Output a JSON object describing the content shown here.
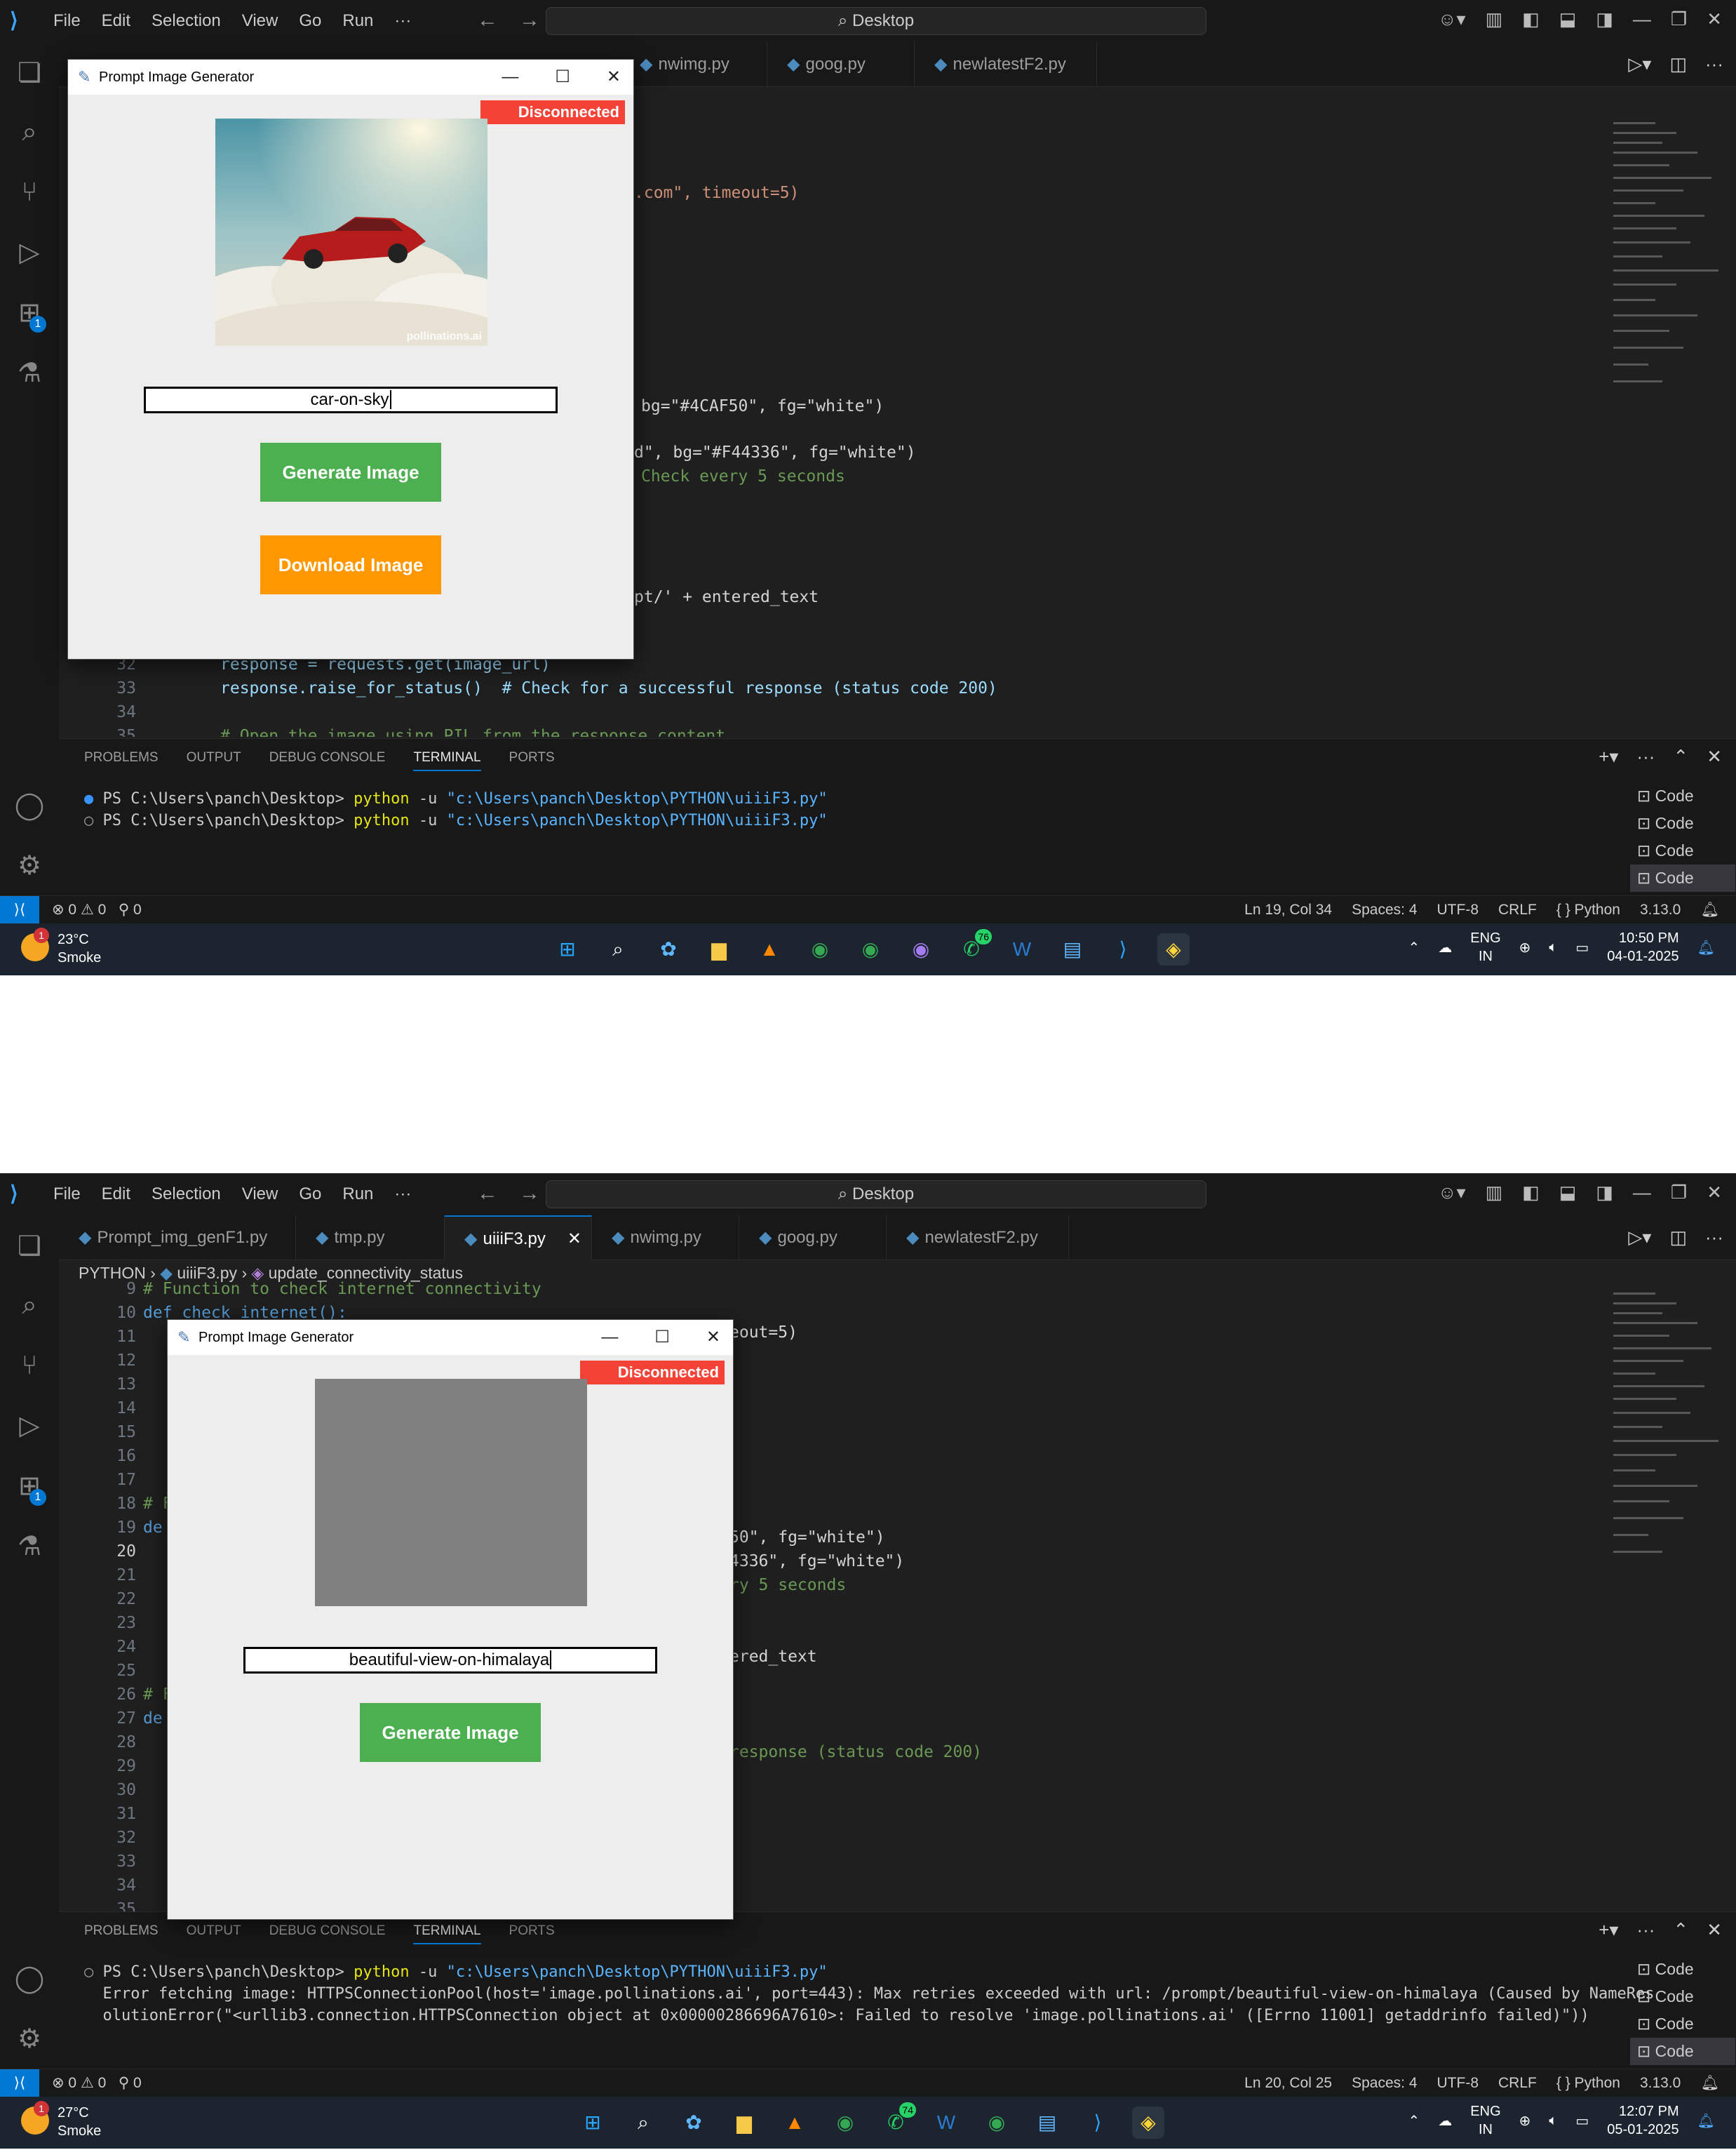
{
  "menu": [
    "File",
    "Edit",
    "Selection",
    "View",
    "Go",
    "Run",
    "···"
  ],
  "search": {
    "label": "Desktop"
  },
  "tabs": {
    "s1": [
      "nwimg.py",
      "goog.py",
      "newlatestF2.py"
    ],
    "s2": [
      "Prompt_img_genF1.py",
      "tmp.py",
      "uiiiF3.py",
      "nwimg.py",
      "goog.py",
      "newlatestF2.py"
    ]
  },
  "breadcrumb": {
    "folder": "PYTHON",
    "file": "uiiiF3.py",
    "symbol": "update_connectivity_status"
  },
  "editor1": {
    "lines": [
      {
        "n": "32",
        "text": "response = requests.get(image_url)"
      },
      {
        "n": "33",
        "text": "response.raise_for_status()  # Check for a successful response (status code 200)"
      },
      {
        "n": "34",
        "text": ""
      },
      {
        "n": "35",
        "text": "# Open the image using PIL from the response content"
      }
    ],
    "frag": [
      ".com\", timeout=5)",
      "bg=\"#4CAF50\", fg=\"white\")",
      "d\", bg=\"#F44336\", fg=\"white\")",
      "Check every 5 seconds",
      "pt/' + entered_text"
    ]
  },
  "editor2": {
    "lines": [
      {
        "n": "9",
        "text": "# Function to check internet connectivity"
      },
      {
        "n": "10",
        "text": "def check_internet():"
      },
      {
        "n": "11",
        "text": ""
      },
      {
        "n": "12",
        "text": ""
      },
      {
        "n": "13",
        "text": ""
      },
      {
        "n": "14",
        "text": ""
      },
      {
        "n": "15",
        "text": ""
      },
      {
        "n": "16",
        "text": ""
      },
      {
        "n": "17",
        "text": ""
      },
      {
        "n": "18",
        "text": "# F"
      },
      {
        "n": "19",
        "text": "de"
      },
      {
        "n": "20",
        "text": ""
      },
      {
        "n": "21",
        "text": ""
      },
      {
        "n": "22",
        "text": ""
      },
      {
        "n": "23",
        "text": ""
      },
      {
        "n": "24",
        "text": ""
      },
      {
        "n": "25",
        "text": ""
      },
      {
        "n": "26",
        "text": "# F"
      },
      {
        "n": "27",
        "text": "de"
      },
      {
        "n": "28",
        "text": ""
      },
      {
        "n": "29",
        "text": ""
      },
      {
        "n": "30",
        "text": ""
      },
      {
        "n": "31",
        "text": ""
      },
      {
        "n": "32",
        "text": ""
      },
      {
        "n": "33",
        "text": ""
      },
      {
        "n": "34",
        "text": ""
      },
      {
        "n": "35",
        "text": ""
      }
    ],
    "frag": [
      "eout=5)",
      "50\", fg=\"white\")",
      "4336\", fg=\"white\")",
      "ry 5 seconds",
      "ered_text",
      "response (status code 200)"
    ]
  },
  "panel": {
    "tabs": [
      "PROBLEMS",
      "OUTPUT",
      "DEBUG CONSOLE",
      "TERMINAL",
      "PORTS"
    ],
    "terminals": [
      "Code",
      "Code",
      "Code",
      "Code"
    ]
  },
  "terminal1": {
    "prompt": "PS C:\\Users\\panch\\Desktop>",
    "cmd": "python",
    "flag": "-u",
    "path": "\"c:\\Users\\panch\\Desktop\\PYTHON\\uiiiF3.py\""
  },
  "terminal2": {
    "prompt": "PS C:\\Users\\panch\\Desktop>",
    "cmd": "python",
    "flag": "-u",
    "path": "\"c:\\Users\\panch\\Desktop\\PYTHON\\uiiiF3.py\"",
    "err1": "Error fetching image: HTTPSConnectionPool(host='image.pollinations.ai', port=443): Max retries exceeded with url: /prompt/beautiful-view-on-himalaya (Caused by NameRes",
    "err2": "olutionError(\"<urllib3.connection.HTTPSConnection object at 0x00000286696A7610>: Failed to resolve 'image.pollinations.ai' ([Errno 11001] getaddrinfo failed)\"))"
  },
  "status1": {
    "problems": "⊗ 0 ⚠ 0",
    "ports": "⚲ 0",
    "pos": "Ln 19, Col 34",
    "spaces": "Spaces: 4",
    "enc": "UTF-8",
    "eol": "CRLF",
    "lang": "{ } Python",
    "ver": "3.13.0"
  },
  "status2": {
    "problems": "⊗ 0 ⚠ 0",
    "ports": "⚲ 0",
    "pos": "Ln 20, Col 25",
    "spaces": "Spaces: 4",
    "enc": "UTF-8",
    "eol": "CRLF",
    "lang": "{ } Python",
    "ver": "3.13.0"
  },
  "taskbar1": {
    "temp": "23°C",
    "cond": "Smoke",
    "lang1": "ENG",
    "lang2": "IN",
    "time": "10:50 PM",
    "date": "04-01-2025",
    "badge": "1",
    "wa": "76"
  },
  "taskbar2": {
    "temp": "27°C",
    "cond": "Smoke",
    "lang1": "ENG",
    "lang2": "IN",
    "time": "12:07 PM",
    "date": "05-01-2025",
    "badge": "1",
    "wa": "74"
  },
  "app1": {
    "title": "Prompt Image Generator",
    "status": "Disconnected",
    "prompt": "car-on-sky",
    "generate": "Generate Image",
    "download": "Download Image",
    "watermark": "pollinations.ai"
  },
  "app2": {
    "title": "Prompt Image Generator",
    "status": "Disconnected",
    "prompt": "beautiful-view-on-himalaya",
    "generate": "Generate Image"
  },
  "colors": {
    "connected_green": "#4CAF50",
    "disconnected_red": "#F44336",
    "download_orange": "#FF9800",
    "accent": "#0078D4"
  }
}
